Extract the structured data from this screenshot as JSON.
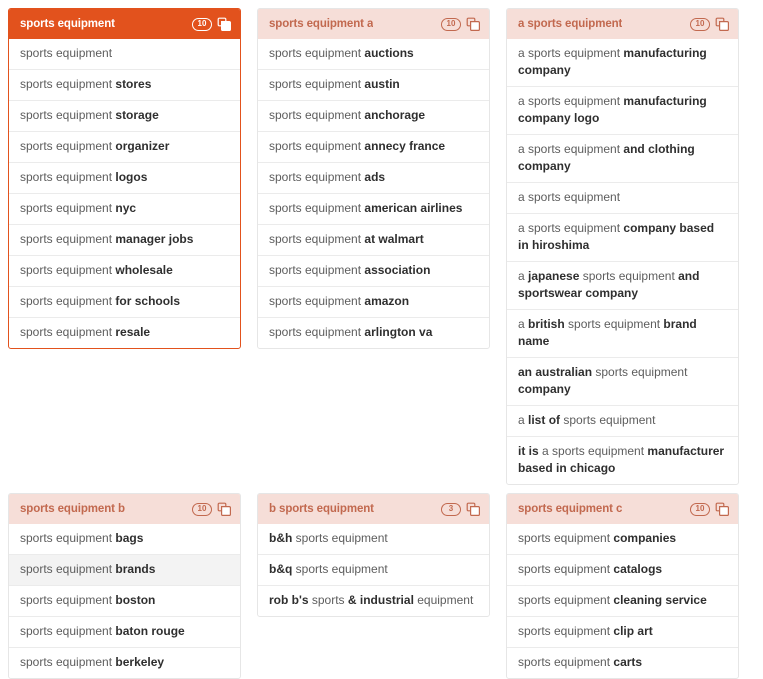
{
  "icons": {
    "copy": "copy-icon"
  },
  "colors": {
    "active_header_bg": "#e2521d",
    "inactive_header_bg": "#f6ded8",
    "accent_text": "#c2694f",
    "body_text": "#5d5d5d",
    "keyword_text": "#2f2f2f",
    "hover_row_bg": "#f3f3f3",
    "border": "#e6e6e6"
  },
  "cards": [
    {
      "id": "sports-equipment",
      "title": "sports equipment",
      "count": "10",
      "active": true,
      "items": [
        {
          "prefix": "sports equipment",
          "bold": "",
          "suffix": ""
        },
        {
          "prefix": "sports equipment ",
          "bold": "stores",
          "suffix": ""
        },
        {
          "prefix": "sports equipment ",
          "bold": "storage",
          "suffix": ""
        },
        {
          "prefix": "sports equipment ",
          "bold": "organizer",
          "suffix": ""
        },
        {
          "prefix": "sports equipment ",
          "bold": "logos",
          "suffix": ""
        },
        {
          "prefix": "sports equipment ",
          "bold": "nyc",
          "suffix": ""
        },
        {
          "prefix": "sports equipment ",
          "bold": "manager jobs",
          "suffix": ""
        },
        {
          "prefix": "sports equipment ",
          "bold": "wholesale",
          "suffix": ""
        },
        {
          "prefix": "sports equipment ",
          "bold": "for schools",
          "suffix": ""
        },
        {
          "prefix": "sports equipment ",
          "bold": "resale",
          "suffix": ""
        }
      ]
    },
    {
      "id": "sports-equipment-a",
      "title": "sports equipment a",
      "count": "10",
      "active": false,
      "items": [
        {
          "prefix": "sports equipment ",
          "bold": "auctions",
          "suffix": ""
        },
        {
          "prefix": "sports equipment ",
          "bold": "austin",
          "suffix": ""
        },
        {
          "prefix": "sports equipment ",
          "bold": "anchorage",
          "suffix": ""
        },
        {
          "prefix": "sports equipment ",
          "bold": "annecy france",
          "suffix": ""
        },
        {
          "prefix": "sports equipment ",
          "bold": "ads",
          "suffix": ""
        },
        {
          "prefix": "sports equipment ",
          "bold": "american airlines",
          "suffix": ""
        },
        {
          "prefix": "sports equipment ",
          "bold": "at walmart",
          "suffix": ""
        },
        {
          "prefix": "sports equipment ",
          "bold": "association",
          "suffix": ""
        },
        {
          "prefix": "sports equipment ",
          "bold": "amazon",
          "suffix": ""
        },
        {
          "prefix": "sports equipment ",
          "bold": "arlington va",
          "suffix": ""
        }
      ]
    },
    {
      "id": "a-sports-equipment",
      "title": "a sports equipment",
      "count": "10",
      "active": false,
      "items": [
        {
          "prefix": "a sports equipment ",
          "bold": "manufacturing company",
          "suffix": ""
        },
        {
          "prefix": "a sports equipment ",
          "bold": "manufacturing company logo",
          "suffix": ""
        },
        {
          "prefix": "a sports equipment ",
          "bold": "and clothing company",
          "suffix": ""
        },
        {
          "prefix": "a sports equipment",
          "bold": "",
          "suffix": ""
        },
        {
          "prefix": "a sports equipment ",
          "bold": "company based in hiroshima",
          "suffix": ""
        },
        {
          "prefix": "a ",
          "bold": "japanese",
          "suffix": " sports equipment ",
          "bold2": "and sportswear company"
        },
        {
          "prefix": "a ",
          "bold": "british",
          "suffix": " sports equipment ",
          "bold2": "brand name"
        },
        {
          "prefix": "",
          "bold": "an australian",
          "suffix": " sports equipment ",
          "bold2": "company"
        },
        {
          "prefix": "a ",
          "bold": "list of",
          "suffix": " sports equipment",
          "bold2": ""
        },
        {
          "prefix": "",
          "bold": "it is",
          "suffix": " a sports equipment ",
          "bold2": "manufacturer based in chicago"
        }
      ]
    },
    {
      "id": "sports-equipment-b",
      "title": "sports equipment b",
      "count": "10",
      "active": false,
      "items": [
        {
          "prefix": "sports equipment ",
          "bold": "bags",
          "suffix": ""
        },
        {
          "prefix": "sports equipment ",
          "bold": "brands",
          "suffix": "",
          "hovered": true
        },
        {
          "prefix": "sports equipment ",
          "bold": "boston",
          "suffix": ""
        },
        {
          "prefix": "sports equipment ",
          "bold": "baton rouge",
          "suffix": ""
        },
        {
          "prefix": "sports equipment ",
          "bold": "berkeley",
          "suffix": ""
        }
      ]
    },
    {
      "id": "b-sports-equipment",
      "title": "b sports equipment",
      "count": "3",
      "active": false,
      "items": [
        {
          "prefix": "",
          "bold": "b&h",
          "suffix": " sports equipment",
          "bold2": ""
        },
        {
          "prefix": "",
          "bold": "b&q",
          "suffix": " sports equipment",
          "bold2": ""
        },
        {
          "prefix": "",
          "bold": "rob b's",
          "suffix": " sports ",
          "bold2": "& industrial",
          "suffix2": " equipment"
        }
      ]
    },
    {
      "id": "sports-equipment-c",
      "title": "sports equipment c",
      "count": "10",
      "active": false,
      "items": [
        {
          "prefix": "sports equipment ",
          "bold": "companies",
          "suffix": ""
        },
        {
          "prefix": "sports equipment ",
          "bold": "catalogs",
          "suffix": ""
        },
        {
          "prefix": "sports equipment ",
          "bold": "cleaning service",
          "suffix": ""
        },
        {
          "prefix": "sports equipment ",
          "bold": "clip art",
          "suffix": ""
        },
        {
          "prefix": "sports equipment ",
          "bold": "carts",
          "suffix": ""
        }
      ]
    }
  ]
}
